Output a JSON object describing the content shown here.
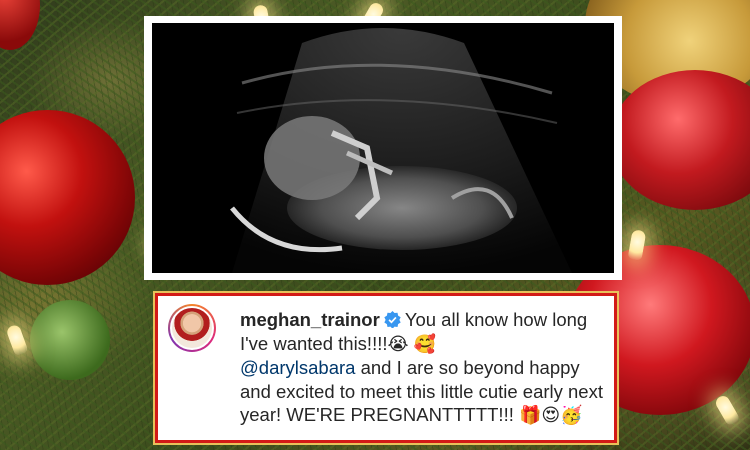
{
  "post": {
    "username": "meghan_trainor",
    "caption_part1": "You all know how long I've wanted this!!!!",
    "emoji_1": "😭",
    "emoji_2": "🥰",
    "mention": "@darylsabara",
    "caption_part2": "and I are so beyond happy and excited to meet this little cutie early next year! WE'RE PREGNANTTTTT!!!",
    "emoji_3": "🎁",
    "emoji_4": "😍",
    "emoji_5": "🥳"
  },
  "colors": {
    "caption_border": "#d21a17",
    "verified_badge": "#3897f0",
    "mention": "#00376b"
  },
  "icons": {
    "verified": "verified-badge-icon",
    "avatar": "profile-avatar"
  }
}
